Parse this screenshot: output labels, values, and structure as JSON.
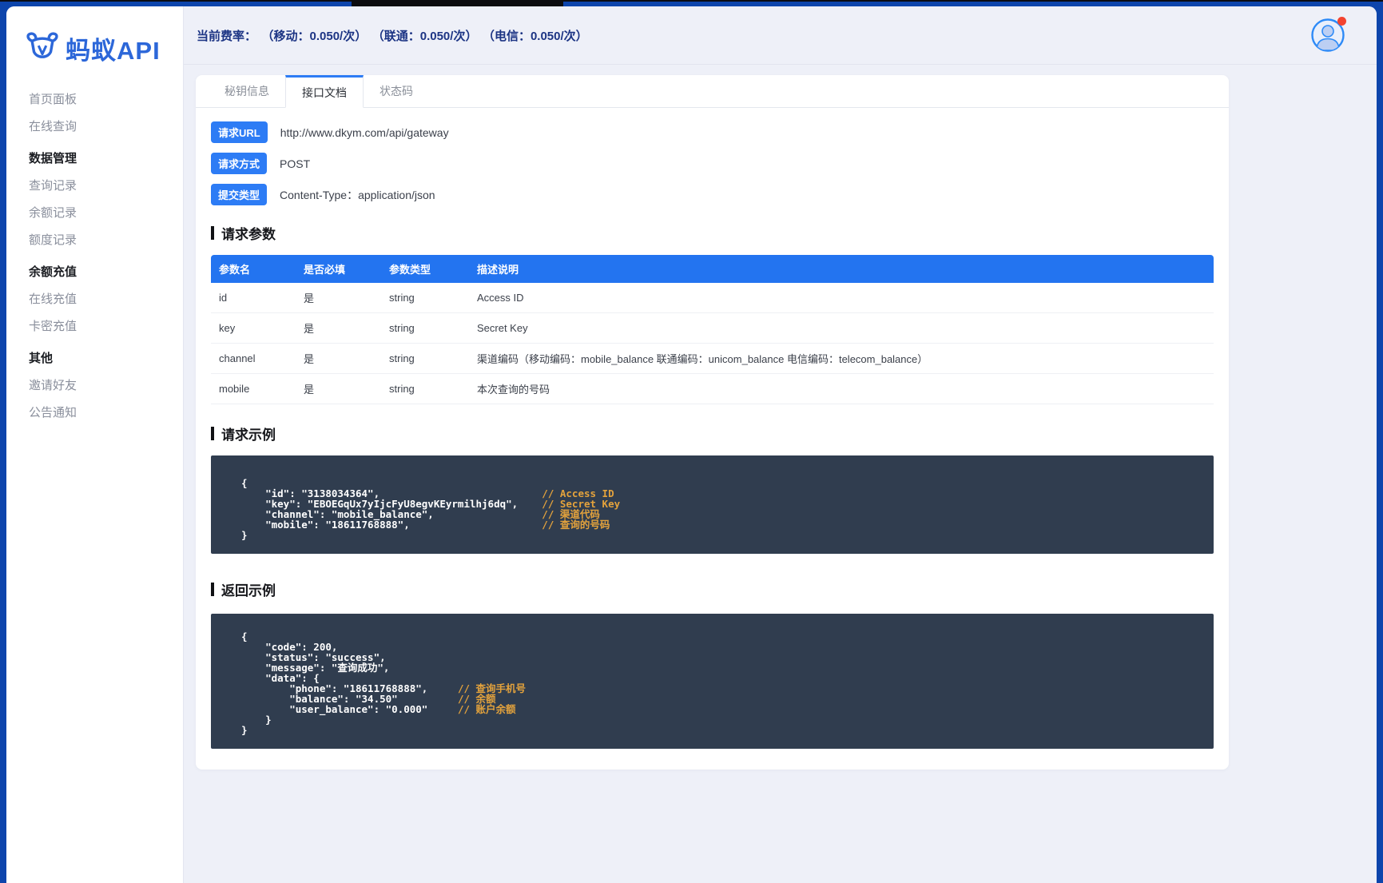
{
  "colors": {
    "frame": "#0d45ac",
    "accent": "#2d7cf5",
    "table_header": "#2374f0",
    "navy_text": "#1c3484",
    "logo_blue": "#2c67d9",
    "code_background": "#303d4f",
    "code_comment": "#e3a23c",
    "notification_red": "#f3432f"
  },
  "sidebar": {
    "logo_text": "蚂蚁API",
    "items": [
      {
        "label": "首页面板",
        "type": "link"
      },
      {
        "label": "在线查询",
        "type": "link"
      },
      {
        "label": "数据管理",
        "type": "section"
      },
      {
        "label": "查询记录",
        "type": "link"
      },
      {
        "label": "余额记录",
        "type": "link"
      },
      {
        "label": "额度记录",
        "type": "link"
      },
      {
        "label": "余额充值",
        "type": "section"
      },
      {
        "label": "在线充值",
        "type": "link"
      },
      {
        "label": "卡密充值",
        "type": "link"
      },
      {
        "label": "其他",
        "type": "section"
      },
      {
        "label": "邀请好友",
        "type": "link"
      },
      {
        "label": "公告通知",
        "type": "link"
      }
    ]
  },
  "topbar": {
    "rate_label": "当前费率：",
    "rates": [
      "（移动：0.050/次）",
      "（联通：0.050/次）",
      "（电信：0.050/次）"
    ]
  },
  "tabs": [
    {
      "label": "秘钥信息",
      "active": false
    },
    {
      "label": "接口文档",
      "active": true
    },
    {
      "label": "状态码",
      "active": false
    }
  ],
  "meta": [
    {
      "badge": "请求URL",
      "value": "http://www.dkym.com/api/gateway"
    },
    {
      "badge": "请求方式",
      "value": "POST"
    },
    {
      "badge": "提交类型",
      "value": "Content-Type：application/json"
    }
  ],
  "sections": {
    "request_params": "请求参数",
    "request_example": "请求示例",
    "response_example": "返回示例"
  },
  "params_table": {
    "headers": [
      "参数名",
      "是否必填",
      "参数类型",
      "描述说明"
    ],
    "rows": [
      [
        "id",
        "是",
        "string",
        "Access ID"
      ],
      [
        "key",
        "是",
        "string",
        "Secret Key"
      ],
      [
        "channel",
        "是",
        "string",
        "渠道编码（移动编码：mobile_balance 联通编码：unicom_balance 电信编码：telecom_balance）"
      ],
      [
        "mobile",
        "是",
        "string",
        "本次查询的号码"
      ]
    ]
  },
  "request_code": {
    "comment_col": 50,
    "lines": [
      {
        "code": "{",
        "comment": ""
      },
      {
        "code": "    \"id\": \"3138034364\",",
        "comment": "// Access ID"
      },
      {
        "code": "    \"key\": \"EBOEGqUx7yIjcFyU8egvKEyrmilhj6dq\",",
        "comment": "// Secret Key"
      },
      {
        "code": "    \"channel\": \"mobile_balance\",",
        "comment": "// 渠道代码"
      },
      {
        "code": "    \"mobile\": \"18611768888\",",
        "comment": "// 查询的号码"
      },
      {
        "code": "}",
        "comment": ""
      }
    ]
  },
  "response_code": {
    "comment_col": 36,
    "lines": [
      {
        "code": "{",
        "comment": ""
      },
      {
        "code": "    \"code\": 200,",
        "comment": ""
      },
      {
        "code": "    \"status\": \"success\",",
        "comment": ""
      },
      {
        "code": "    \"message\": \"查询成功\",",
        "comment": ""
      },
      {
        "code": "    \"data\": {",
        "comment": ""
      },
      {
        "code": "        \"phone\": \"18611768888\",",
        "comment": "// 查询手机号"
      },
      {
        "code": "        \"balance\": \"34.50\"",
        "comment": "// 余额"
      },
      {
        "code": "        \"user_balance\": \"0.000\"",
        "comment": "// 账户余额"
      },
      {
        "code": "    }",
        "comment": ""
      },
      {
        "code": "}",
        "comment": ""
      }
    ]
  }
}
